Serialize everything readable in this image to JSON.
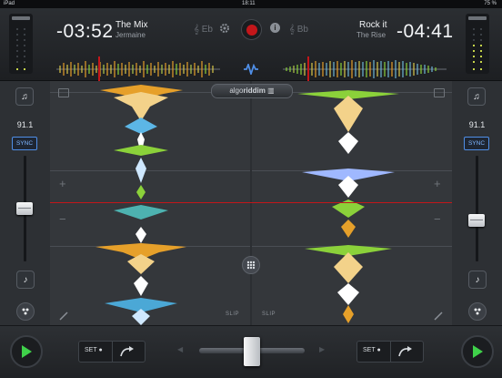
{
  "status_bar": {
    "device": "iPad",
    "time": "18:11",
    "battery": "75 %"
  },
  "deck_left": {
    "time": "-03:52",
    "title": "The Mix",
    "artist": "Jermaine",
    "key": "Eb",
    "bpm": "91.1",
    "sync_label": "SYNC",
    "slip_label": "SLIP",
    "pitch_fader_position": 0.5,
    "set_label": "SET"
  },
  "deck_right": {
    "time": "-04:41",
    "title": "Rock it",
    "artist": "The Rise",
    "key": "Bb",
    "bpm": "91.1",
    "sync_label": "SYNC",
    "slip_label": "SLIP",
    "pitch_fader_position": 0.62,
    "set_label": "SET"
  },
  "logo": {
    "prefix": "algo",
    "suffix": "riddim"
  },
  "crossfader": {
    "position": 0.5
  },
  "colors": {
    "accent_blue": "#4f8ee6",
    "play_green": "#3fd14a",
    "record_red": "#c3161a",
    "meter_on": "#c6d44a",
    "wave_orange": "#e6a02a",
    "wave_green": "#8bd13a"
  },
  "icons": {
    "music_note": "music-note-icon",
    "settings": "gear-icon",
    "info": "info-icon",
    "record": "record-icon",
    "waveform_sync": "waveform-icon",
    "pencil": "pencil-icon",
    "grid": "grid-icon",
    "play": "play-icon",
    "loop": "loop-arrow-icon"
  }
}
